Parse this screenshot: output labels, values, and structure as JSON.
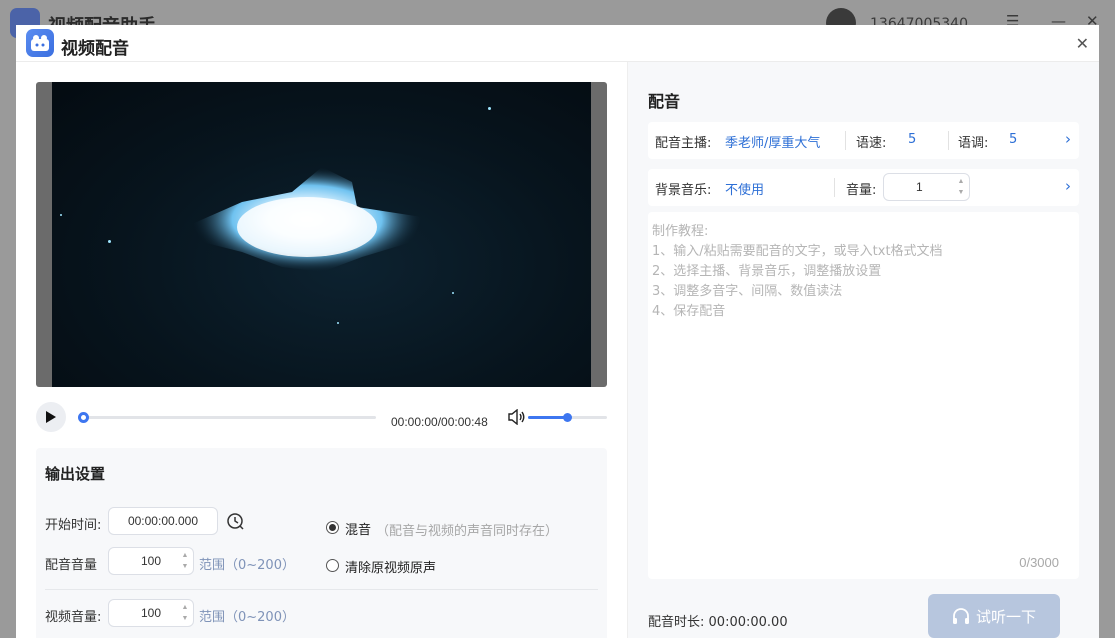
{
  "background_app": {
    "title": "视频配音助手",
    "phone": "13647005340"
  },
  "dialog": {
    "title": "视频配音",
    "close_icon": "close-icon"
  },
  "player": {
    "time": "00:00:00/00:00:48",
    "progress": 0,
    "volume_level": 0.5
  },
  "output": {
    "title": "输出设置",
    "start_time_label": "开始时间:",
    "start_time_value": "00:00:00.000",
    "dub_volume_label": "配音音量",
    "dub_volume_value": "100",
    "dub_volume_range": "范围（0~200）",
    "video_volume_label": "视频音量:",
    "video_volume_value": "100",
    "video_volume_range": "范围（0~200）",
    "mix_label": "混音",
    "mix_hint": "（配音与视频的声音同时存在）",
    "remove_label": "清除原视频原声"
  },
  "dubbing": {
    "title": "配音",
    "anchor_label": "配音主播:",
    "anchor_value": "季老师/厚重大气",
    "speed_label": "语速:",
    "speed_value": "5",
    "pitch_label": "语调:",
    "pitch_value": "5",
    "bgm_label": "背景音乐:",
    "bgm_value": "不使用",
    "bgm_volume_label": "音量:",
    "bgm_volume_value": "1",
    "tutorial": [
      "制作教程:",
      "1、输入/粘贴需要配音的文字，或导入txt格式文档",
      "2、选择主播、背景音乐，调整播放设置",
      "3、调整多音字、间隔、数值读法",
      "4、保存配音"
    ],
    "counter": "0/3000",
    "duration_label": "配音时长:",
    "duration_value": "00:00:00.00",
    "listen_button": "试听一下"
  },
  "colors": {
    "accent": "#3d76f0",
    "link": "#2d6fd6",
    "listen_button_bg": "#b7c6de"
  }
}
